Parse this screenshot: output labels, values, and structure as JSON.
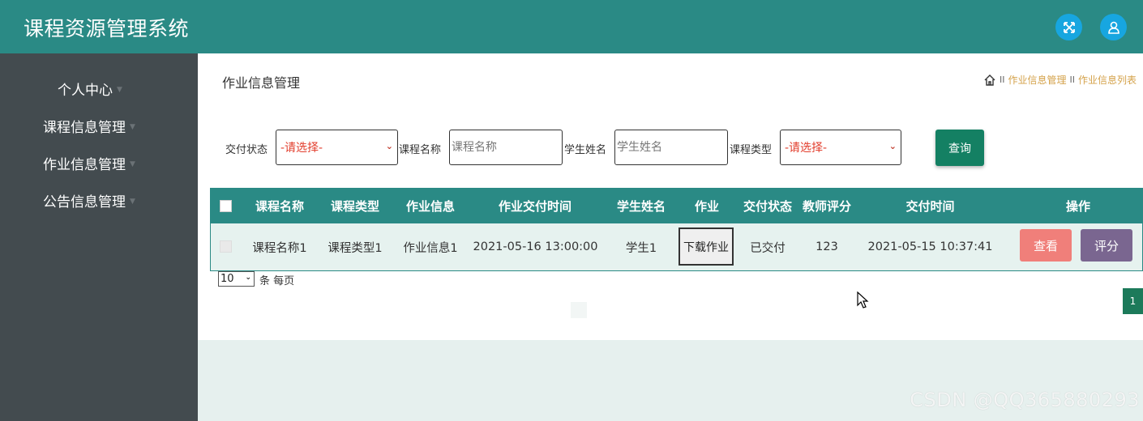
{
  "header": {
    "app_title": "课程资源管理系统",
    "icons": [
      "fullscreen-icon",
      "user-icon"
    ]
  },
  "sidebar": {
    "items": [
      {
        "label": "个人中心"
      },
      {
        "label": "课程信息管理"
      },
      {
        "label": "作业信息管理"
      },
      {
        "label": "公告信息管理"
      }
    ]
  },
  "page": {
    "title": "作业信息管理",
    "breadcrumb": [
      "作业信息管理",
      "作业信息列表"
    ]
  },
  "search": {
    "status_label": "交付状态",
    "status_value": "-请选择-",
    "course_name_label": "课程名称",
    "course_name_placeholder": "课程名称",
    "student_name_label": "学生姓名",
    "student_name_placeholder": "学生姓名",
    "course_type_label": "课程类型",
    "course_type_value": "-请选择-",
    "query_label": "查询"
  },
  "table": {
    "columns": [
      "课程名称",
      "课程类型",
      "作业信息",
      "作业交付时间",
      "学生姓名",
      "作业",
      "交付状态",
      "教师评分",
      "交付时间",
      "操作"
    ],
    "rows": [
      {
        "course_name": "课程名称1",
        "course_type": "课程类型1",
        "homework_info": "作业信息1",
        "homework_due": "2021-05-16 13:00:00",
        "student_name": "学生1",
        "download_label": "下载作业",
        "status": "已交付",
        "score": "123",
        "submit_time": "2021-05-15 10:37:41",
        "view_label": "查看",
        "rate_label": "评分"
      }
    ]
  },
  "pagination": {
    "page_size": "10",
    "per_page_text": "条 每页",
    "current_page": "1"
  },
  "watermark": "CSDN @QQ365880293",
  "colors": {
    "header": "#2a8a85",
    "sidebar": "#434b4f",
    "query_button": "#148063",
    "view_button": "#f07f7a",
    "rate_button": "#7a6690",
    "breadcrumb": "#d4a24a"
  }
}
